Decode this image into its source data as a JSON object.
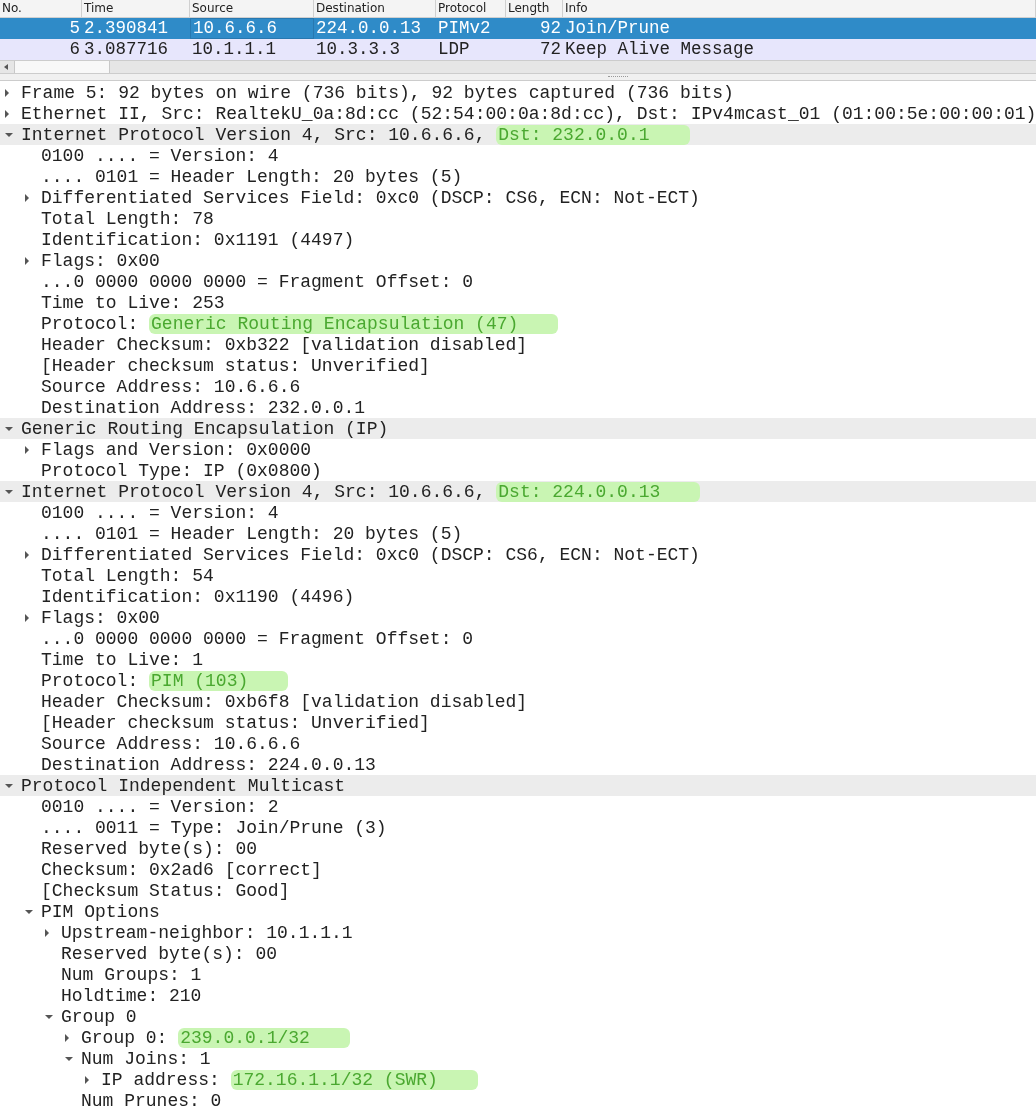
{
  "packet_list": {
    "columns": [
      "No.",
      "Time",
      "Source",
      "Destination",
      "Protocol",
      "Length",
      "Info"
    ],
    "rows": [
      {
        "selected": true,
        "cells": [
          "5",
          "2.390841",
          "10.6.6.6",
          "224.0.0.13",
          "PIMv2",
          "92",
          "Join/Prune"
        ]
      },
      {
        "selected": false,
        "cells": [
          "6",
          "3.087716",
          "10.1.1.1",
          "10.3.3.3",
          "LDP",
          "72",
          "Keep Alive Message"
        ]
      }
    ]
  },
  "details": [
    {
      "text": "Frame 5: 92 bytes on wire (736 bits), 92 bytes captured (736 bits)",
      "expanded": false
    },
    {
      "text": "Ethernet II, Src: RealtekU_0a:8d:cc (52:54:00:0a:8d:cc), Dst: IPv4mcast_01 (01:00:5e:00:00:01)",
      "expanded": false
    },
    {
      "text": "Internet Protocol Version 4, Src: 10.6.6.6, ",
      "highlight": "Dst: 232.0.0.1",
      "expanded": true,
      "children": [
        {
          "text": "0100 .... = Version: 4"
        },
        {
          "text": ".... 0101 = Header Length: 20 bytes (5)"
        },
        {
          "text": "Differentiated Services Field: 0xc0 (DSCP: CS6, ECN: Not-ECT)",
          "expanded": false
        },
        {
          "text": "Total Length: 78"
        },
        {
          "text": "Identification: 0x1191 (4497)"
        },
        {
          "text": "Flags: 0x00",
          "expanded": false
        },
        {
          "text": "...0 0000 0000 0000 = Fragment Offset: 0"
        },
        {
          "text": "Time to Live: 253"
        },
        {
          "text": "Protocol: ",
          "highlight": "Generic Routing Encapsulation (47)"
        },
        {
          "text": "Header Checksum: 0xb322 [validation disabled]"
        },
        {
          "text": "[Header checksum status: Unverified]"
        },
        {
          "text": "Source Address: 10.6.6.6"
        },
        {
          "text": "Destination Address: 232.0.0.1"
        }
      ]
    },
    {
      "text": "Generic Routing Encapsulation (IP)",
      "expanded": true,
      "children": [
        {
          "text": "Flags and Version: 0x0000",
          "expanded": false
        },
        {
          "text": "Protocol Type: IP (0x0800)"
        }
      ]
    },
    {
      "text": "Internet Protocol Version 4, Src: 10.6.6.6, ",
      "highlight": "Dst: 224.0.0.13",
      "expanded": true,
      "children": [
        {
          "text": "0100 .... = Version: 4"
        },
        {
          "text": ".... 0101 = Header Length: 20 bytes (5)"
        },
        {
          "text": "Differentiated Services Field: 0xc0 (DSCP: CS6, ECN: Not-ECT)",
          "expanded": false
        },
        {
          "text": "Total Length: 54"
        },
        {
          "text": "Identification: 0x1190 (4496)"
        },
        {
          "text": "Flags: 0x00",
          "expanded": false
        },
        {
          "text": "...0 0000 0000 0000 = Fragment Offset: 0"
        },
        {
          "text": "Time to Live: 1"
        },
        {
          "text": "Protocol: ",
          "highlight": "PIM (103)"
        },
        {
          "text": "Header Checksum: 0xb6f8 [validation disabled]"
        },
        {
          "text": "[Header checksum status: Unverified]"
        },
        {
          "text": "Source Address: 10.6.6.6"
        },
        {
          "text": "Destination Address: 224.0.0.13"
        }
      ]
    },
    {
      "text": "Protocol Independent Multicast",
      "expanded": true,
      "children": [
        {
          "text": "0010 .... = Version: 2"
        },
        {
          "text": ".... 0011 = Type: Join/Prune (3)"
        },
        {
          "text": "Reserved byte(s): 00"
        },
        {
          "text": "Checksum: 0x2ad6 [correct]"
        },
        {
          "text": "[Checksum Status: Good]"
        },
        {
          "text": "PIM Options",
          "expanded": true,
          "children": [
            {
              "text": "Upstream-neighbor: 10.1.1.1",
              "expanded": false
            },
            {
              "text": "Reserved byte(s): 00"
            },
            {
              "text": "Num Groups: 1"
            },
            {
              "text": "Holdtime: 210"
            },
            {
              "text": "Group 0",
              "expanded": true,
              "children": [
                {
                  "text": "Group 0: ",
                  "highlight": "239.0.0.1/32",
                  "expanded": false
                },
                {
                  "text": "Num Joins: 1",
                  "expanded": true,
                  "children": [
                    {
                      "text": "IP address: ",
                      "highlight": "172.16.1.1/32 (SWR)",
                      "expanded": false
                    }
                  ]
                },
                {
                  "text": "Num Prunes: 0"
                }
              ]
            }
          ]
        }
      ]
    }
  ]
}
